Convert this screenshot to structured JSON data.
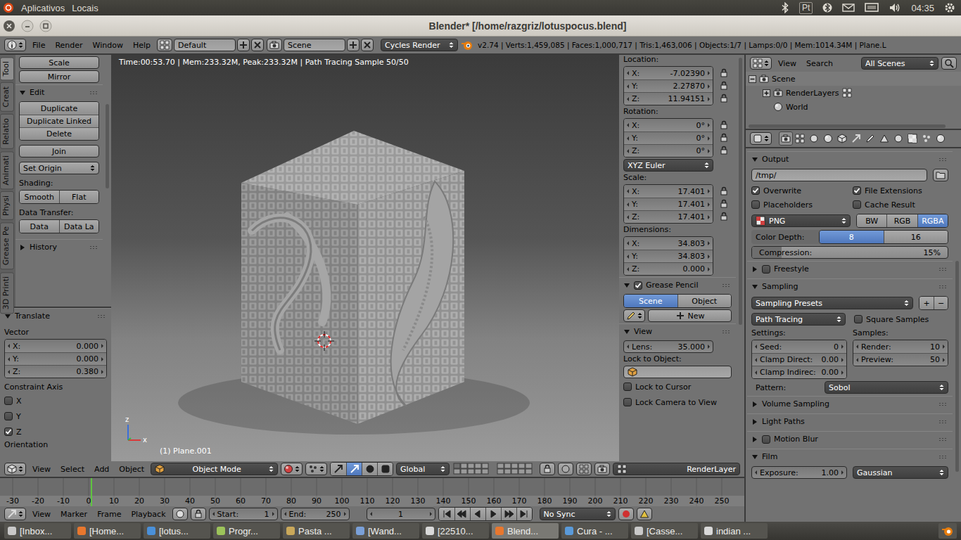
{
  "top_panel": {
    "menus": [
      "Aplicativos",
      "Locais"
    ],
    "keyboard": "Pt",
    "clock": "04:35"
  },
  "window": {
    "title": "Blender* [/home/razgriz/lotuspocus.blend]"
  },
  "info_header": {
    "menus": [
      "File",
      "Render",
      "Window",
      "Help"
    ],
    "layout": "Default",
    "scene": "Scene",
    "engine": "Cycles Render",
    "stats": "v2.74 | Verts:1,459,085 | Faces:1,000,717 | Tris:1,463,006 | Objects:1/7 | Lamps:0/0 | Mem:1014.34M | Plane.L"
  },
  "tool_shelf": {
    "tabs": [
      {
        "label": "Tool",
        "selected": true
      },
      {
        "label": "Creat",
        "selected": false
      },
      {
        "label": "Relatio",
        "selected": false
      },
      {
        "label": "Animati",
        "selected": false
      },
      {
        "label": "Physi",
        "selected": false
      },
      {
        "label": "Grease Pe",
        "selected": false
      },
      {
        "label": "3D Printi",
        "selected": false
      }
    ],
    "transform_buttons": [
      "Scale",
      "Mirror"
    ],
    "edit": {
      "title": "Edit",
      "expanded": true,
      "buttons": [
        "Duplicate",
        "Duplicate Linked",
        "Delete"
      ],
      "join": "Join",
      "set_origin": "Set Origin",
      "shading_label": "Shading:",
      "shading": [
        "Smooth",
        "Flat"
      ],
      "data_transfer_label": "Data Transfer:",
      "data_transfer": [
        "Data",
        "Data La"
      ]
    },
    "history": {
      "title": "History",
      "expanded": false
    }
  },
  "operator": {
    "title": "Translate",
    "expanded": true,
    "vector_label": "Vector",
    "vector": [
      {
        "axis": "X:",
        "value": "0.000"
      },
      {
        "axis": "Y:",
        "value": "0.000"
      },
      {
        "axis": "Z:",
        "value": "0.380"
      }
    ],
    "constraint_label": "Constraint Axis",
    "constraints": [
      {
        "label": "X",
        "checked": false
      },
      {
        "label": "Y",
        "checked": false
      },
      {
        "label": "Z",
        "checked": true
      }
    ],
    "orientation_label": "Orientation"
  },
  "viewport": {
    "status": "Time:00:53.70 | Mem:233.32M, Peak:233.32M | Path Tracing Sample 50/50",
    "object": "(1) Plane.001",
    "axes": [
      "z",
      "x"
    ]
  },
  "n_panel": {
    "location_label": "Location:",
    "location": [
      {
        "axis": "X:",
        "value": "-7.02390"
      },
      {
        "axis": "Y:",
        "value": "2.27870"
      },
      {
        "axis": "Z:",
        "value": "11.94151"
      }
    ],
    "rotation_label": "Rotation:",
    "rotation": [
      {
        "axis": "X:",
        "value": "0°"
      },
      {
        "axis": "Y:",
        "value": "0°"
      },
      {
        "axis": "Z:",
        "value": "0°"
      }
    ],
    "rotation_mode": "XYZ Euler",
    "scale_label": "Scale:",
    "scale": [
      {
        "axis": "X:",
        "value": "17.401"
      },
      {
        "axis": "Y:",
        "value": "17.401"
      },
      {
        "axis": "Z:",
        "value": "17.401"
      }
    ],
    "dimensions_label": "Dimensions:",
    "dimensions": [
      {
        "axis": "X:",
        "value": "34.803"
      },
      {
        "axis": "Y:",
        "value": "34.803"
      },
      {
        "axis": "Z:",
        "value": "0.000"
      }
    ],
    "grease_pencil": {
      "title": "Grease Pencil",
      "enabled": true,
      "expanded": true,
      "sources": [
        {
          "label": "Scene",
          "selected": true
        },
        {
          "label": "Object",
          "selected": false
        }
      ],
      "new": "New"
    },
    "view": {
      "title": "View",
      "expanded": true,
      "lens_label": "Lens:",
      "lens": "35.000",
      "lock_object_label": "Lock to Object:",
      "locks": [
        {
          "label": "Lock to Cursor",
          "checked": false
        },
        {
          "label": "Lock Camera to View",
          "checked": false
        }
      ]
    }
  },
  "view3d_header": {
    "menus": [
      "View",
      "Select",
      "Add",
      "Object"
    ],
    "mode": "Object Mode",
    "manipulators": [
      {
        "selected": false
      },
      {
        "selected": true
      },
      {
        "selected": false
      },
      {
        "selected": false
      }
    ],
    "orientation": "Global",
    "render_layer": "RenderLayer"
  },
  "timeline": {
    "ticks": [
      "-30",
      "-20",
      "-10",
      "0",
      "10",
      "20",
      "30",
      "40",
      "50",
      "60",
      "70",
      "80",
      "90",
      "100",
      "110",
      "120",
      "130",
      "140",
      "150",
      "160",
      "170",
      "180",
      "190",
      "200",
      "210",
      "220",
      "230",
      "240",
      "250"
    ],
    "level": 0.122,
    "menus": [
      "View",
      "Marker",
      "Frame",
      "Playback"
    ],
    "start_label": "Start:",
    "start": "1",
    "end_label": "End:",
    "end": "250",
    "frame": "1",
    "sync": "No Sync"
  },
  "outliner": {
    "menus": [
      "View",
      "Search"
    ],
    "filter": "All Scenes",
    "tree": [
      {
        "label": "Scene",
        "expanded": true,
        "children": [
          {
            "label": "RenderLayers",
            "expanded": false
          },
          {
            "label": "World"
          }
        ]
      }
    ]
  },
  "properties": {
    "tabs": [
      {
        "selected": true
      },
      {
        "selected": false
      },
      {
        "selected": false
      },
      {
        "selected": false
      },
      {
        "selected": false
      },
      {
        "selected": false
      },
      {
        "selected": false
      },
      {
        "selected": false
      },
      {
        "selected": false
      },
      {
        "selected": false
      },
      {
        "selected": false
      },
      {
        "selected": false
      }
    ],
    "output": {
      "title": "Output",
      "expanded": true,
      "path": "/tmp/",
      "options": [
        {
          "label": "Overwrite",
          "checked": true
        },
        {
          "label": "File Extensions",
          "checked": true
        },
        {
          "label": "Placeholders",
          "checked": false
        },
        {
          "label": "Cache Result",
          "checked": false
        }
      ],
      "format": "PNG",
      "color_modes": [
        {
          "label": "BW",
          "selected": false
        },
        {
          "label": "RGB",
          "selected": false
        },
        {
          "label": "RGBA",
          "selected": true
        }
      ],
      "color_depth_label": "Color Depth:",
      "color_depths": [
        {
          "label": "8",
          "selected": true
        },
        {
          "label": "16",
          "selected": false
        }
      ],
      "compression_label": "Compression:",
      "compression": "15%",
      "compression_level": 0.15
    },
    "freestyle": {
      "title": "Freestyle",
      "expanded": false,
      "enabled": false
    },
    "sampling": {
      "title": "Sampling",
      "expanded": true,
      "presets": "Sampling Presets",
      "preset_add": "+",
      "preset_remove": "−",
      "integrator": "Path Tracing",
      "square_samples": {
        "label": "Square Samples",
        "checked": false
      },
      "settings_label": "Settings:",
      "settings": [
        {
          "label": "Seed:",
          "value": "0"
        },
        {
          "label": "Clamp Direct:",
          "value": "0.00"
        },
        {
          "label": "Clamp Indirec:",
          "value": "0.00"
        }
      ],
      "samples_label": "Samples:",
      "samples": [
        {
          "label": "Render:",
          "value": "10"
        },
        {
          "label": "Preview:",
          "value": "50"
        }
      ],
      "pattern_label": "Pattern:",
      "pattern": "Sobol"
    },
    "collapsed_panels": [
      {
        "title": "Volume Sampling",
        "kind": "plain"
      },
      {
        "title": "Light Paths",
        "kind": "plain"
      },
      {
        "title": "Motion Blur",
        "kind": "toggle",
        "enabled": false
      }
    ],
    "film": {
      "title": "Film",
      "expanded": true,
      "exposure_label": "Exposure:",
      "exposure": "1.00",
      "filter": "Gaussian"
    }
  },
  "taskbar": [
    {
      "label": "[Inbox...",
      "selected": false
    },
    {
      "label": "[Home...",
      "selected": false
    },
    {
      "label": "[lotus...",
      "selected": false
    },
    {
      "label": "Progr...",
      "selected": false
    },
    {
      "label": "Pasta ...",
      "selected": false
    },
    {
      "label": "[Wand...",
      "selected": false
    },
    {
      "label": "[22510...",
      "selected": false
    },
    {
      "label": "Blend...",
      "selected": true
    },
    {
      "label": "Cura - ...",
      "selected": false
    },
    {
      "label": "[Casse...",
      "selected": false
    },
    {
      "label": "indian ...",
      "selected": false
    }
  ]
}
